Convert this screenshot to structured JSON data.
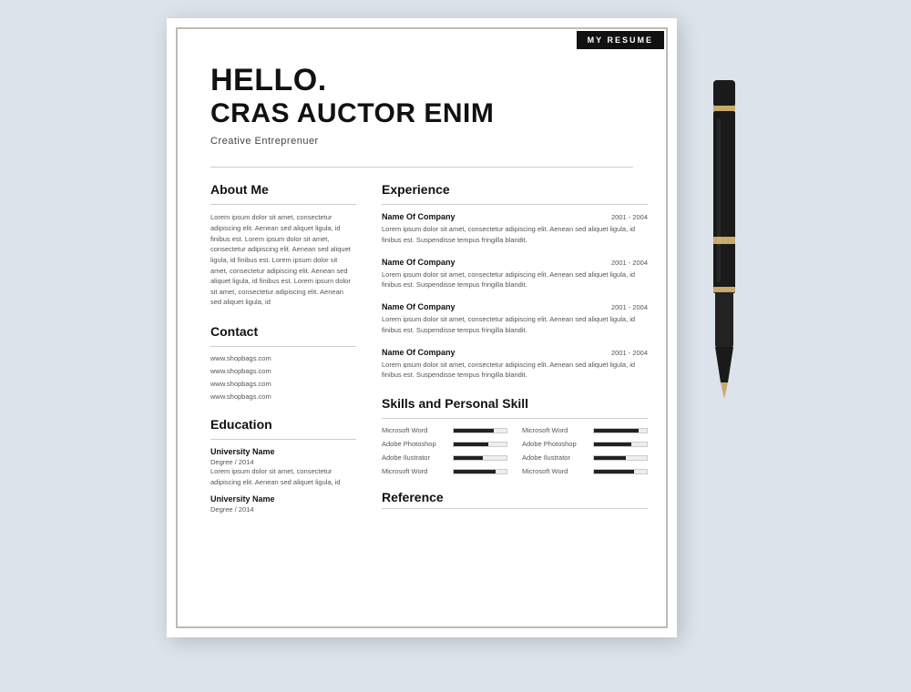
{
  "badge": "MY RESUME",
  "header": {
    "hello": "HELLO.",
    "name": "CRAS AUCTOR ENIM",
    "subtitle": "Creative Entreprenuer"
  },
  "about": {
    "title": "About Me",
    "text": "Lorem ipsum dolor sit amet, consectetur adipiscing elit. Aenean sed aliquet ligula, id finibus est. Lorem ipsum dolor sit amet, consectetur adipiscing elit. Aenean sed aliquet ligula, id finibus est. Lorem ipsum dolor sit amet, consectetur adipiscing elit. Aenean sed aliquet ligula, id finibus est. Lorem ipsum dolor sit amet, consectetur adipiscing elit. Aenean sed aliquet ligula, id"
  },
  "contact": {
    "title": "Contact",
    "items": [
      "www.shopbags.com",
      "www.shopbags.com",
      "www.shopbags.com",
      "www.shopbags.com"
    ]
  },
  "education": {
    "title": "Education",
    "entries": [
      {
        "name": "University Name",
        "degree": "Degree / 2014",
        "text": "Lorem ipsum dolor sit amet, consectetur adipiscing elit. Aenean sed aliquet ligula, id"
      },
      {
        "name": "University Name",
        "degree": "Degree / 2014",
        "text": ""
      }
    ]
  },
  "experience": {
    "title": "Experience",
    "entries": [
      {
        "company": "Name Of Company",
        "date": "2001 - 2004",
        "desc": "Lorem ipsum dolor sit amet, consectetur adipiscing elit. Aenean sed aliquet ligula, id finibus est. Suspendisse tempus fringilla blandit."
      },
      {
        "company": "Name Of Company",
        "date": "2001 - 2004",
        "desc": "Lorem ipsum dolor sit amet, consectetur adipiscing elit. Aenean sed aliquet ligula, id finibus est. Suspendisse tempus fringilla blandit."
      },
      {
        "company": "Name Of Company",
        "date": "2001 - 2004",
        "desc": "Lorem ipsum dolor sit amet, consectetur adipiscing elit. Aenean sed aliquet ligula, id finibus est. Suspendisse tempus fringilla blandit."
      },
      {
        "company": "Name Of Company",
        "date": "2001 - 2004",
        "desc": "Lorem ipsum dolor sit amet, consectetur adipiscing elit. Aenean sed aliquet ligula, id finibus est. Suspendisse tempus fringilla blandit."
      }
    ]
  },
  "skills": {
    "title": "Skills and Personal Skill",
    "items": [
      {
        "name": "Microsoft  Word",
        "fill": 75
      },
      {
        "name": "Microsoft  Word",
        "fill": 85
      },
      {
        "name": "Adobe Photoshop",
        "fill": 65
      },
      {
        "name": "Adobe Photoshop",
        "fill": 70
      },
      {
        "name": "Adobe Ilustrator",
        "fill": 55
      },
      {
        "name": "Adobe Ilustrator",
        "fill": 60
      },
      {
        "name": "Microsoft  Word",
        "fill": 80
      },
      {
        "name": "Microsoft  Word",
        "fill": 75
      }
    ]
  },
  "reference": {
    "title": "Reference"
  }
}
